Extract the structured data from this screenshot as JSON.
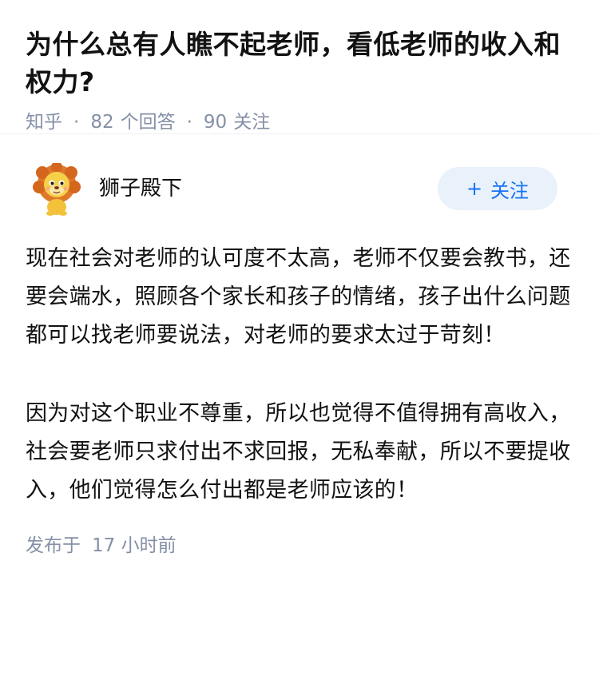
{
  "question": {
    "title": "为什么总有人瞧不起老师，看低老师的收入和权力?",
    "source": "知乎",
    "separator": "·",
    "answer_count": "82",
    "answer_label": "个回答",
    "follower_count": "90",
    "follower_label": "关注"
  },
  "answer": {
    "author": {
      "name": "狮子殿下",
      "avatar_icon": "lion-cartoon-avatar"
    },
    "follow_button": {
      "icon": "+",
      "label": "关注",
      "color": "#1772f6",
      "background": "#e9f1fb"
    },
    "paragraphs": [
      "现在社会对老师的认可度不太高，老师不仅要会教书，还要会端水，照顾各个家长和孩子的情绪，孩子出什么问题都可以找老师要说法，对老师的要求太过于苛刻！",
      "因为对这个职业不尊重，所以也觉得不值得拥有高收入，社会要老师只求付出不求回报，无私奉献，所以不要提收入，他们觉得怎么付出都是老师应该的！"
    ],
    "published_label": "发布于",
    "published_ago": "17 小时前"
  },
  "colors": {
    "text": "#121212",
    "meta": "#8590a6",
    "accent": "#1772f6"
  }
}
